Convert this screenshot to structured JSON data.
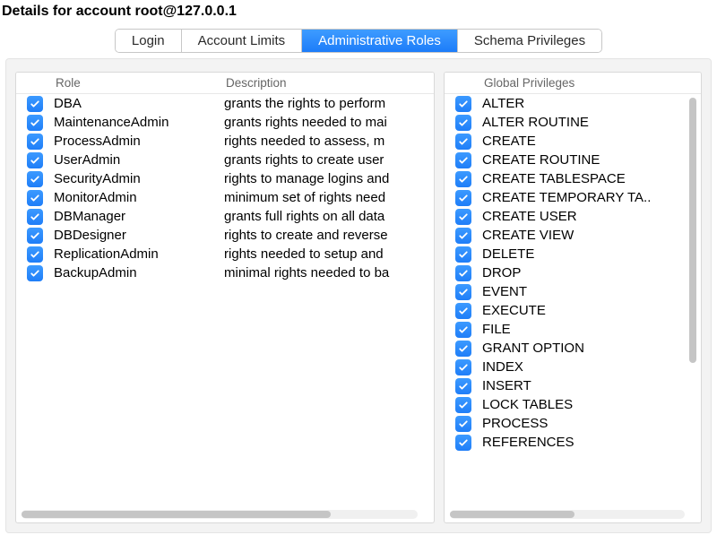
{
  "title": "Details for account root@127.0.0.1",
  "tabs": [
    {
      "label": "Login",
      "active": false
    },
    {
      "label": "Account Limits",
      "active": false
    },
    {
      "label": "Administrative Roles",
      "active": true
    },
    {
      "label": "Schema Privileges",
      "active": false
    }
  ],
  "roles_header": {
    "role": "Role",
    "description": "Description"
  },
  "roles": [
    {
      "checked": true,
      "name": "DBA",
      "description": "grants the rights to perform"
    },
    {
      "checked": true,
      "name": "MaintenanceAdmin",
      "description": "grants rights needed to mai"
    },
    {
      "checked": true,
      "name": "ProcessAdmin",
      "description": "rights needed to assess, m"
    },
    {
      "checked": true,
      "name": "UserAdmin",
      "description": "grants rights to create user"
    },
    {
      "checked": true,
      "name": "SecurityAdmin",
      "description": "rights to manage logins and"
    },
    {
      "checked": true,
      "name": "MonitorAdmin",
      "description": "minimum set of rights need"
    },
    {
      "checked": true,
      "name": "DBManager",
      "description": "grants full rights on all data"
    },
    {
      "checked": true,
      "name": "DBDesigner",
      "description": "rights to create and reverse"
    },
    {
      "checked": true,
      "name": "ReplicationAdmin",
      "description": "rights needed to setup and "
    },
    {
      "checked": true,
      "name": "BackupAdmin",
      "description": "minimal rights needed to ba"
    }
  ],
  "privileges_header": "Global Privileges",
  "privileges": [
    {
      "checked": true,
      "name": "ALTER"
    },
    {
      "checked": true,
      "name": "ALTER ROUTINE"
    },
    {
      "checked": true,
      "name": "CREATE"
    },
    {
      "checked": true,
      "name": "CREATE ROUTINE"
    },
    {
      "checked": true,
      "name": "CREATE TABLESPACE"
    },
    {
      "checked": true,
      "name": "CREATE TEMPORARY TA.."
    },
    {
      "checked": true,
      "name": "CREATE USER"
    },
    {
      "checked": true,
      "name": "CREATE VIEW"
    },
    {
      "checked": true,
      "name": "DELETE"
    },
    {
      "checked": true,
      "name": "DROP"
    },
    {
      "checked": true,
      "name": "EVENT"
    },
    {
      "checked": true,
      "name": "EXECUTE"
    },
    {
      "checked": true,
      "name": "FILE"
    },
    {
      "checked": true,
      "name": "GRANT OPTION"
    },
    {
      "checked": true,
      "name": "INDEX"
    },
    {
      "checked": true,
      "name": "INSERT"
    },
    {
      "checked": true,
      "name": "LOCK TABLES"
    },
    {
      "checked": true,
      "name": "PROCESS"
    },
    {
      "checked": true,
      "name": "REFERENCES"
    }
  ]
}
